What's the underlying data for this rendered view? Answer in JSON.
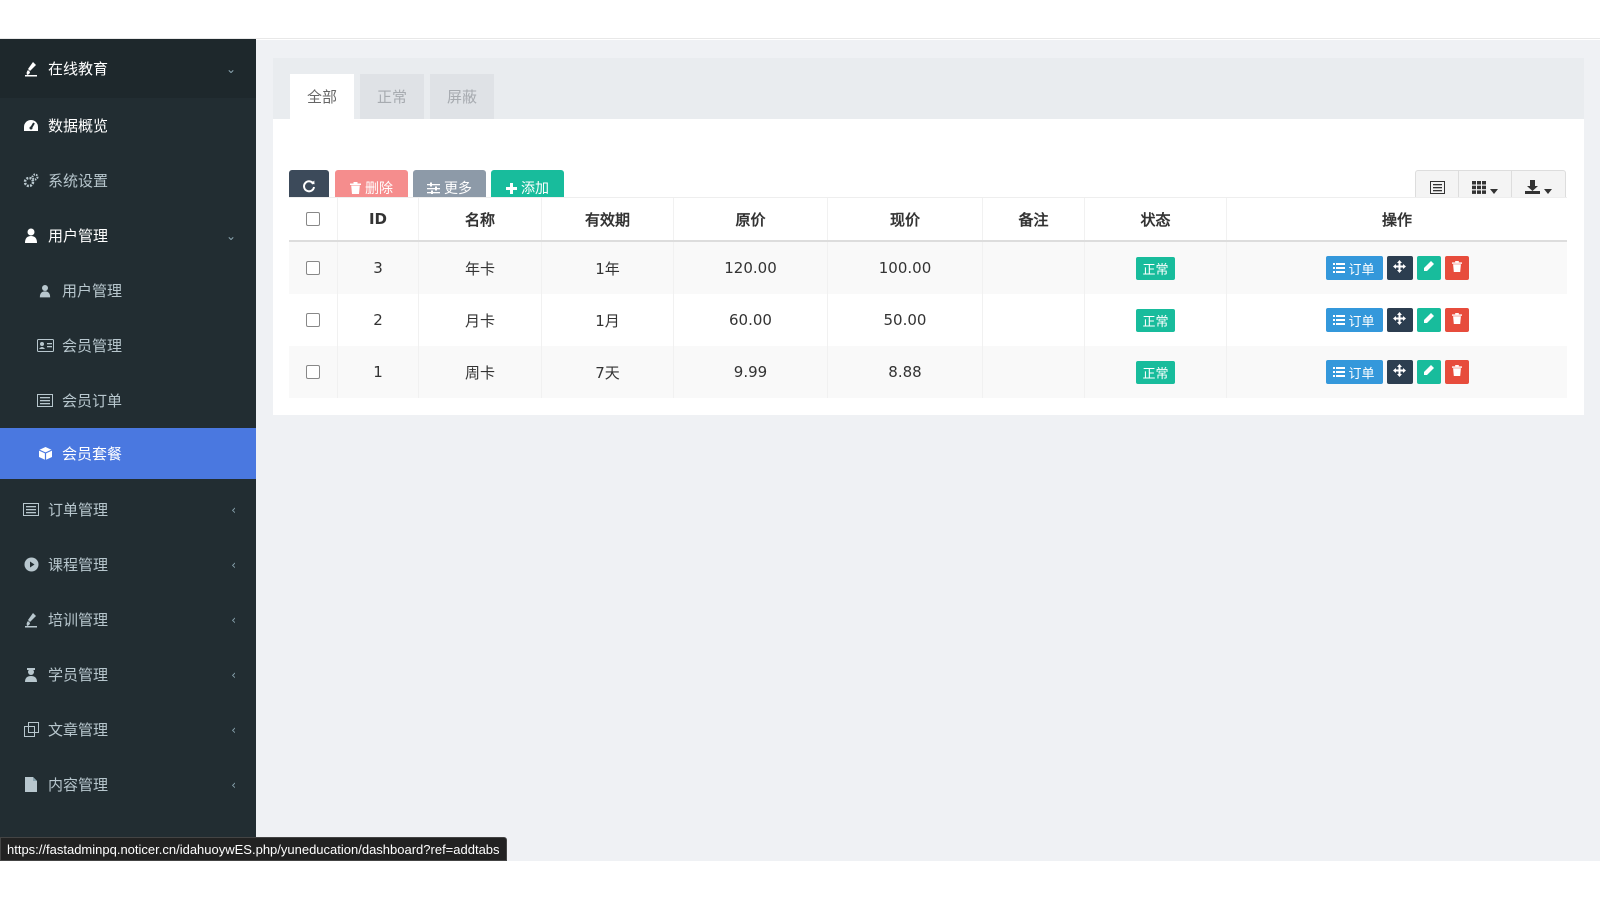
{
  "sidebar": {
    "items": [
      {
        "label": "在线教育",
        "icon": "paint-brush-icon",
        "arrow": "⌄"
      },
      {
        "label": "数据概览",
        "icon": "dashboard-icon"
      },
      {
        "label": "系统设置",
        "icon": "cogs-icon"
      },
      {
        "label": "用户管理",
        "icon": "user-icon",
        "arrow": "⌄"
      },
      {
        "label": "用户管理",
        "icon": "user-icon"
      },
      {
        "label": "会员管理",
        "icon": "id-card-icon"
      },
      {
        "label": "会员订单",
        "icon": "list-alt-icon"
      },
      {
        "label": "会员套餐",
        "icon": "cube-icon"
      },
      {
        "label": "订单管理",
        "icon": "list-alt-icon",
        "arrow": "‹"
      },
      {
        "label": "课程管理",
        "icon": "play-circle-icon",
        "arrow": "‹"
      },
      {
        "label": "培训管理",
        "icon": "paint-brush-icon",
        "arrow": "‹"
      },
      {
        "label": "学员管理",
        "icon": "user-secret-icon",
        "arrow": "‹"
      },
      {
        "label": "文章管理",
        "icon": "clone-icon",
        "arrow": "‹"
      },
      {
        "label": "内容管理",
        "icon": "file-icon",
        "arrow": "‹"
      }
    ]
  },
  "tabs": [
    {
      "label": "全部",
      "active": true
    },
    {
      "label": "正常",
      "active": false
    },
    {
      "label": "屏蔽",
      "active": false
    }
  ],
  "toolbar": {
    "delete_label": "删除",
    "more_label": "更多",
    "add_label": "添加"
  },
  "table": {
    "headers": [
      "ID",
      "名称",
      "有效期",
      "原价",
      "现价",
      "备注",
      "状态",
      "操作"
    ],
    "rows": [
      {
        "id": "3",
        "name": "年卡",
        "validity": "1年",
        "original_price": "120.00",
        "current_price": "100.00",
        "remark": "",
        "status": "正常"
      },
      {
        "id": "2",
        "name": "月卡",
        "validity": "1月",
        "original_price": "60.00",
        "current_price": "50.00",
        "remark": "",
        "status": "正常"
      },
      {
        "id": "1",
        "name": "周卡",
        "validity": "7天",
        "original_price": "9.99",
        "current_price": "8.88",
        "remark": "",
        "status": "正常"
      }
    ],
    "order_button_label": "订单"
  },
  "statusbar": {
    "url": "https://fastadminpq.noticer.cn/idahuoywES.php/yuneducation/dashboard?ref=addtabs"
  },
  "colors": {
    "sidebar_bg": "#222d32",
    "active_menu": "#4a78e0",
    "refresh_btn": "#3c4a5a",
    "delete_btn": "#f58d8d",
    "more_btn": "#8d9aa8",
    "add_btn": "#18bc9c",
    "status_badge": "#18bc9c",
    "order_btn": "#3498db",
    "drag_btn": "#2c3e50",
    "edit_btn": "#18bc9c",
    "del_row_btn": "#e74c3c"
  }
}
